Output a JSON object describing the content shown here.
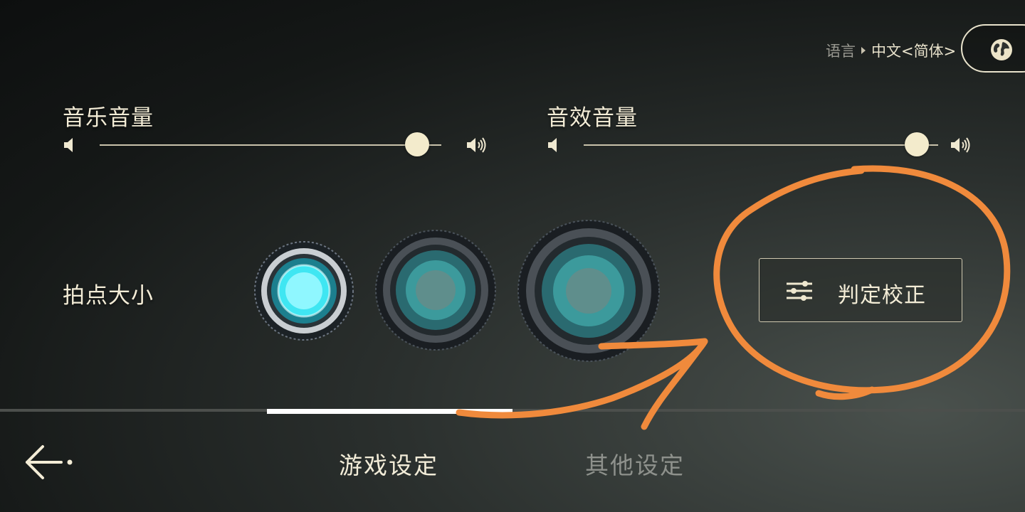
{
  "language": {
    "label": "语言",
    "value": "中文<简体>"
  },
  "icons": {
    "globe": "globe-icon",
    "back": "back-arrow-icon",
    "speaker_low": "volume-low-icon",
    "speaker_high": "volume-high-icon",
    "calibration": "sliders-icon"
  },
  "music_volume": {
    "label": "音乐音量",
    "value": 0.93
  },
  "sfx_volume": {
    "label": "音效音量",
    "value": 0.94
  },
  "note_size": {
    "label": "拍点大小",
    "options": [
      "small",
      "medium",
      "large"
    ],
    "selected_index": 0
  },
  "calibration_button": {
    "label": "判定校正"
  },
  "tabs": [
    {
      "label": "游戏设定",
      "active": true
    },
    {
      "label": "其他设定",
      "active": false
    }
  ],
  "colors": {
    "accent": "#f3ebcc",
    "annotation": "#f08a3c",
    "note_glow": "#3fe6f2",
    "inactive_tab": "#8e918c"
  }
}
